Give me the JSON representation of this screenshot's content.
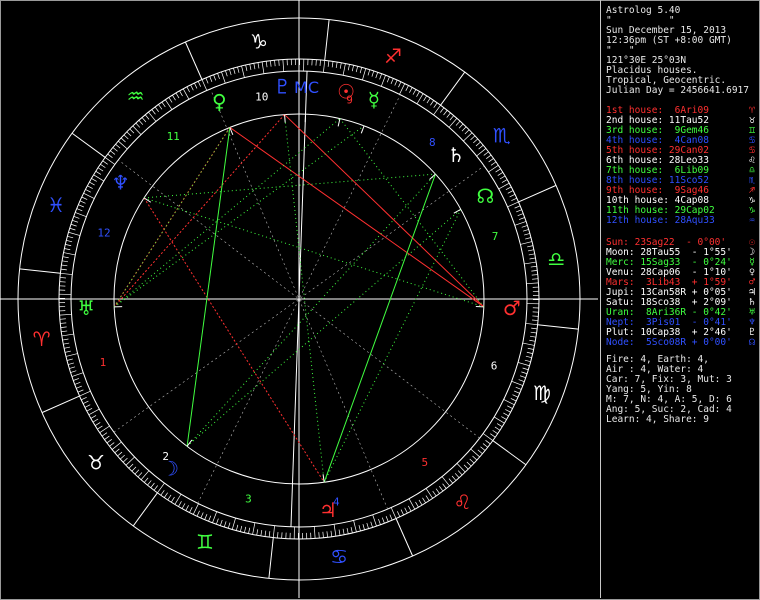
{
  "header": {
    "program": "Astrolog 5.40",
    "name_line": "\"          \"",
    "date": "Sun December 15, 2013",
    "time": "12:36pm (ST +8:00 GMT)",
    "place": "\"   \"",
    "coords": "121°30E 25°03N",
    "house_system": "Placidus houses.",
    "zodiac": "Tropical, Geocentric.",
    "julian_day": "Julian Day = 2456641.6917"
  },
  "houses": [
    {
      "text": "1st house:  6Ari09",
      "color": "#ff3030",
      "glyph": "♈"
    },
    {
      "text": "2nd house: 11Tau52",
      "color": "#ffffff",
      "glyph": "♉"
    },
    {
      "text": "3rd house:  9Gem46",
      "color": "#40ff40",
      "glyph": "♊"
    },
    {
      "text": "4th house:  4Can08",
      "color": "#3050ff",
      "glyph": "♋"
    },
    {
      "text": "5th house: 29Can02",
      "color": "#ff3030",
      "glyph": "♋"
    },
    {
      "text": "6th house: 28Leo33",
      "color": "#ffffff",
      "glyph": "♌"
    },
    {
      "text": "7th house:  6Lib09",
      "color": "#40ff40",
      "glyph": "♎"
    },
    {
      "text": "8th house: 11Sco52",
      "color": "#3050ff",
      "glyph": "♏"
    },
    {
      "text": "9th house:  9Sag46",
      "color": "#ff3030",
      "glyph": "♐"
    },
    {
      "text": "10th house: 4Cap08",
      "color": "#ffffff",
      "glyph": "♑"
    },
    {
      "text": "11th house: 29Cap02",
      "color": "#40ff40",
      "glyph": "♑"
    },
    {
      "text": "12th house: 28Aqu33",
      "color": "#3050ff",
      "glyph": "♒"
    }
  ],
  "planets": [
    {
      "text": "Sun: 23Sag22  - 0°00'",
      "color": "#ff3030",
      "glyph": "☉"
    },
    {
      "text": "Moon: 28Tau55  - 1°55'",
      "color": "#ffffff",
      "glyph": "☽"
    },
    {
      "text": "Merc: 15Sag33  - 0°24'",
      "color": "#40ff40",
      "glyph": "☿"
    },
    {
      "text": "Venu: 28Cap06  - 1°10'",
      "color": "#ffffff",
      "glyph": "♀"
    },
    {
      "text": "Mars:  3Lib43  + 1°59'",
      "color": "#ff3030",
      "glyph": "♂"
    },
    {
      "text": "Jupi: 13Can58R + 0°05'",
      "color": "#ffffff",
      "glyph": "♃"
    },
    {
      "text": "Satu: 18Sco38  + 2°09'",
      "color": "#ffffff",
      "glyph": "♄"
    },
    {
      "text": "Uran:  8Ari36R - 0°42'",
      "color": "#40ff40",
      "glyph": "♅"
    },
    {
      "text": "Nept:  3Pis01  - 0°41'",
      "color": "#3050ff",
      "glyph": "♆"
    },
    {
      "text": "Plut: 10Cap38  + 2°46'",
      "color": "#ffffff",
      "glyph": "♇"
    },
    {
      "text": "Node:  5Sco08R + 0°00'",
      "color": "#3050ff",
      "glyph": "☊"
    }
  ],
  "summary": [
    "Fire: 4, Earth: 4,",
    "Air : 4, Water: 4",
    "Car: 7, Fix: 3, Mut: 3",
    "Yang: 5, Yin: 8",
    "M: 7, N: 4, A: 5, D: 6",
    "Ang: 5, Suc: 2, Cad: 4",
    "Learn: 4, Share: 9"
  ],
  "wheel": {
    "ascendant_deg": 6.15,
    "sign_glyphs": [
      "♈",
      "♉",
      "♊",
      "♋",
      "♌",
      "♍",
      "♎",
      "♏",
      "♐",
      "♑",
      "♒",
      "♓"
    ],
    "sign_colors": [
      "#ff3030",
      "#ffffff",
      "#40ff40",
      "#3050ff",
      "#ff3030",
      "#ffffff",
      "#40ff40",
      "#3050ff",
      "#ff3030",
      "#ffffff",
      "#40ff40",
      "#3050ff"
    ],
    "house_cusps_deg": [
      6.15,
      41.87,
      69.77,
      94.13,
      119.03,
      148.55,
      186.15,
      221.87,
      249.77,
      274.13,
      299.03,
      328.55
    ],
    "house_numbers": [
      "1",
      "2",
      "3",
      "4",
      "5",
      "6",
      "7",
      "8",
      "9",
      "10",
      "11",
      "12"
    ],
    "house_number_colors": [
      "#ff3030",
      "#ffffff",
      "#40ff40",
      "#3050ff",
      "#ff3030",
      "#ffffff",
      "#40ff40",
      "#3050ff",
      "#ff3030",
      "#ffffff",
      "#40ff40",
      "#3050ff"
    ],
    "planets": [
      {
        "id": "sun",
        "glyph": "☉",
        "lon": 263.37,
        "color": "#ff3030"
      },
      {
        "id": "moon",
        "glyph": "☽",
        "lon": 58.92,
        "color": "#3050ff"
      },
      {
        "id": "mercury",
        "glyph": "☿",
        "lon": 255.55,
        "color": "#40ff40"
      },
      {
        "id": "venus",
        "glyph": "♀",
        "lon": 298.1,
        "color": "#40ff40"
      },
      {
        "id": "mars",
        "glyph": "♂",
        "lon": 183.72,
        "color": "#ff3030"
      },
      {
        "id": "jupiter",
        "glyph": "♃",
        "lon": 103.97,
        "color": "#ff3030"
      },
      {
        "id": "saturn",
        "glyph": "♄",
        "lon": 228.63,
        "color": "#ffffff"
      },
      {
        "id": "uranus",
        "glyph": "♅",
        "lon": 8.6,
        "color": "#40ff40"
      },
      {
        "id": "neptune",
        "glyph": "♆",
        "lon": 333.02,
        "color": "#3050ff"
      },
      {
        "id": "pluto",
        "glyph": "♇",
        "lon": 280.63,
        "color": "#3050ff"
      },
      {
        "id": "node",
        "glyph": "☊",
        "lon": 215.13,
        "color": "#40ff40"
      },
      {
        "id": "midheaven",
        "glyph": "MC",
        "lon": 274.13,
        "color": "#3050ff"
      },
      {
        "id": "ascendant",
        "glyph": "As",
        "lon": 6.15,
        "color": "#ff3030"
      }
    ],
    "aspects": [
      {
        "a": "venus",
        "b": "mars",
        "color": "#ff3030",
        "dash": "none"
      },
      {
        "a": "pluto",
        "b": "mars",
        "color": "#ff3030",
        "dash": "none"
      },
      {
        "a": "venus",
        "b": "uranus",
        "color": "#ff3030",
        "dash": "2,2"
      },
      {
        "a": "pluto",
        "b": "uranus",
        "color": "#ff3030",
        "dash": "2,2"
      },
      {
        "a": "neptune",
        "b": "jupiter",
        "color": "#ff3030",
        "dash": "2,2"
      },
      {
        "a": "venus",
        "b": "moon",
        "color": "#40ff40",
        "dash": "none"
      },
      {
        "a": "saturn",
        "b": "jupiter",
        "color": "#40ff40",
        "dash": "none"
      },
      {
        "a": "uranus",
        "b": "sun",
        "color": "#40ff40",
        "dash": "1,3"
      },
      {
        "a": "uranus",
        "b": "mercury",
        "color": "#40ff40",
        "dash": "1,3"
      },
      {
        "a": "sun",
        "b": "mars",
        "color": "#40ff40",
        "dash": "1,3"
      },
      {
        "a": "neptune",
        "b": "mars",
        "color": "#40ff40",
        "dash": "1,3"
      },
      {
        "a": "saturn",
        "b": "moon",
        "color": "#40ff40",
        "dash": "1,3"
      },
      {
        "a": "pluto",
        "b": "jupiter",
        "color": "#40ff40",
        "dash": "1,3"
      },
      {
        "a": "moon",
        "b": "node",
        "color": "#40ff40",
        "dash": "1,3"
      },
      {
        "a": "neptune",
        "b": "saturn",
        "color": "#40ff40",
        "dash": "1,3"
      },
      {
        "a": "node",
        "b": "jupiter",
        "color": "#40ff40",
        "dash": "1,3"
      },
      {
        "a": "uranus",
        "b": "venus",
        "color": "#40ff40",
        "dash": "1,3"
      }
    ]
  }
}
